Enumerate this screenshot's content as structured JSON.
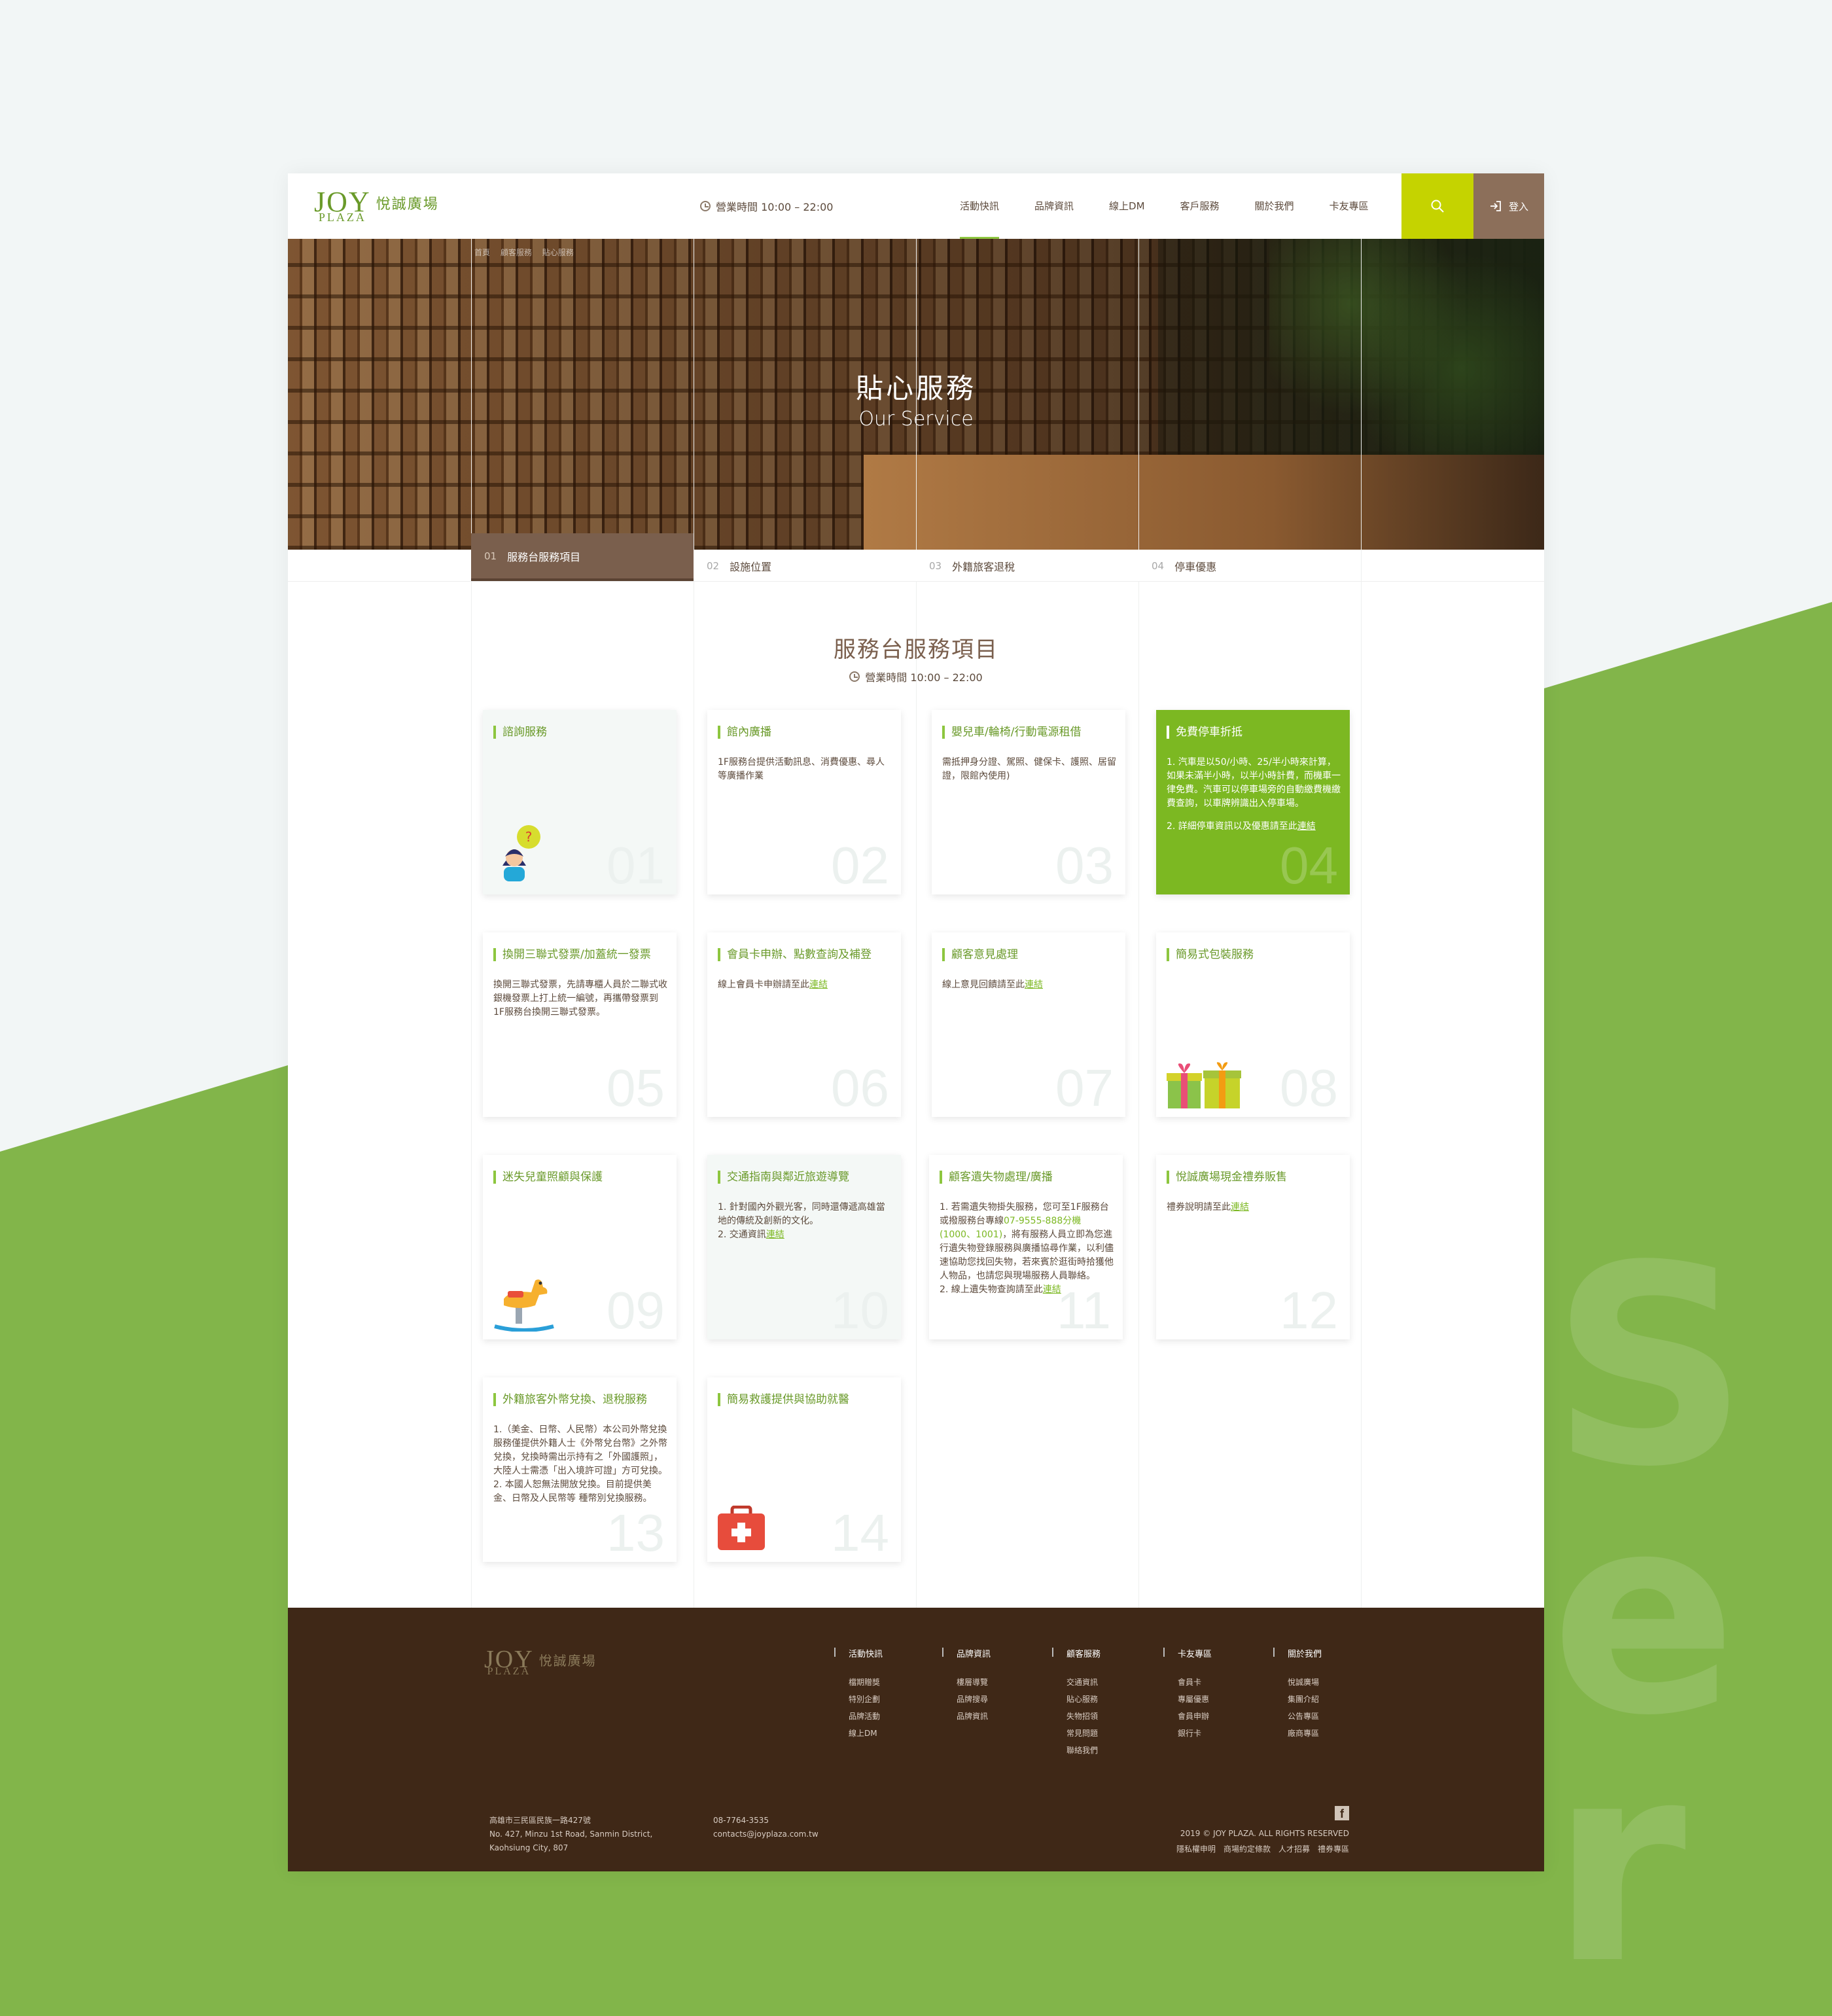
{
  "colors": {
    "brand_green": "#8dc63f",
    "brown": "#7a5f4d",
    "footer_bg": "#3f2817",
    "search_bg": "#c5d300",
    "login_bg": "#8c6f5a"
  },
  "header": {
    "logo_mark": "JOY",
    "logo_sub": "PLAZA",
    "logo_cn": "悅誠廣場",
    "hours": "營業時間 10:00 – 22:00",
    "nav": [
      "活動快訊",
      "品牌資訊",
      "線上DM",
      "客戶服務",
      "關於我們",
      "卡友專區"
    ],
    "search_icon": "search-icon",
    "login_label": "登入"
  },
  "hero": {
    "breadcrumb": [
      "首頁",
      "顧客服務",
      "貼心服務"
    ],
    "title": "貼心服務",
    "subtitle": "Our Service"
  },
  "tabs": [
    {
      "num": "01",
      "label": "服務台服務項目"
    },
    {
      "num": "02",
      "label": "設施位置"
    },
    {
      "num": "03",
      "label": "外籍旅客退稅"
    },
    {
      "num": "04",
      "label": "停車優惠"
    }
  ],
  "section": {
    "title": "服務台服務項目",
    "hours": "營業時間  10:00 – 22:00"
  },
  "cards": [
    {
      "num": "01",
      "title": "諮詢服務",
      "body": "",
      "link": "",
      "icon": "question-woman-icon"
    },
    {
      "num": "02",
      "title": "館內廣播",
      "body": "1F服務台提供活動訊息、消費優惠、尋人等廣播作業",
      "link": ""
    },
    {
      "num": "03",
      "title": "嬰兒車/輪椅/行動電源租借",
      "body": "需抵押身分證、駕照、健保卡、護照、居留證，限館內使用)",
      "link": ""
    },
    {
      "num": "04",
      "title": "免費停車折抵",
      "body1": "1. 汽車是以50/小時、25/半小時來計算，如果未滿半小時，以半小時計費，而機車一律免費。汽車可以停車場旁的自動繳費機繳費查詢，以車牌辨識出入停車場。",
      "body2": "2. 詳細停車資訊以及優惠請至此",
      "link": "連結"
    },
    {
      "num": "05",
      "title": "換開三聯式發票/加蓋統一發票",
      "body": "換開三聯式發票，先請專櫃人員於二聯式收銀機發票上打上統一編號，再攜帶發票到1F服務台換開三聯式發票。",
      "link": ""
    },
    {
      "num": "06",
      "title": "會員卡申辦、點數查詢及補登",
      "body": "線上會員卡申辦請至此",
      "link": "連結"
    },
    {
      "num": "07",
      "title": "顧客意見處理",
      "body": "線上意見回饋請至此",
      "link": "連結"
    },
    {
      "num": "08",
      "title": "簡易式包裝服務",
      "body": "",
      "link": "",
      "icon": "gift-box-icon"
    },
    {
      "num": "09",
      "title": "迷失兒童照顧與保護",
      "body": "",
      "link": "",
      "icon": "rocking-horse-icon"
    },
    {
      "num": "10",
      "title": "交通指南與鄰近旅遊導覽",
      "body1": "1. 針對國內外觀光客，同時還傳遞高雄當地的傳統及創新的文化。",
      "body2": "2. 交通資訊",
      "link": "連結"
    },
    {
      "num": "11",
      "title": "顧客遺失物處理/廣播",
      "body1": "1. 若需遺失物掛失服務，您可至1F服務台或撥服務台專線",
      "phone": "07-9555-888分機(1000、1001)",
      "body1b": "，將有服務人員立即為您進行遺失物登錄服務與廣播協尋作業，以利儘速協助您找回失物，若來賓於逛街時拾獲他人物品，也請您與現場服務人員聯絡。",
      "body2": "2. 線上遺失物查詢請至此",
      "link": "連結"
    },
    {
      "num": "12",
      "title": "悅誠廣場現金禮券販售",
      "body": "禮券說明請至此",
      "link": "連結"
    },
    {
      "num": "13",
      "title": "外籍旅客外幣兌換、退稅服務",
      "body1": "1.（美金、日幣、人民幣）本公司外幣兌換服務僅提供外籍人士《外幣兌台幣》之外幣兌換，兌換時需出示持有之「外國護照」，大陸人士需憑「出入境許可證」方可兌換。",
      "body2": "2. 本國人恕無法開放兌換。目前提供美金、日幣及人民幣等 種幣別兌換服務。",
      "link": ""
    },
    {
      "num": "14",
      "title": "簡易救護提供與協助就醫",
      "body": "",
      "link": "",
      "icon": "first-aid-kit-icon"
    }
  ],
  "footer": {
    "logo_mark": "JOY",
    "logo_sub": "PLAZA",
    "logo_cn": "悅誠廣場",
    "columns": [
      {
        "title": "活動快訊",
        "links": [
          "檔期贈獎",
          "特別企劃",
          "品牌活動",
          "線上DM"
        ]
      },
      {
        "title": "品牌資訊",
        "links": [
          "樓層導覽",
          "品牌搜尋",
          "品牌資訊"
        ]
      },
      {
        "title": "顧客服務",
        "links": [
          "交通資訊",
          "貼心服務",
          "失物招領",
          "常見問題",
          "聯絡我們"
        ]
      },
      {
        "title": "卡友專區",
        "links": [
          "會員卡",
          "專屬優惠",
          "會員申辦",
          "銀行卡"
        ]
      },
      {
        "title": "關於我們",
        "links": [
          "悅誠廣場",
          "集團介紹",
          "公告專區",
          "廠商專區"
        ]
      }
    ],
    "address": [
      "高雄市三民區民族一路427號",
      "No. 427, Minzu 1st Road, Sanmin District,",
      "Kaohsiung City, 807"
    ],
    "phone": "08-7764-3535",
    "email": "contacts@joyplaza.com.tw",
    "facebook_icon": "facebook-icon",
    "copyright": "2019 © JOY PLAZA.  ALL RIGHTS RESERVED",
    "legal_links": [
      "隱私權申明",
      "商場約定條款",
      "人才招募",
      "禮券專區"
    ]
  }
}
